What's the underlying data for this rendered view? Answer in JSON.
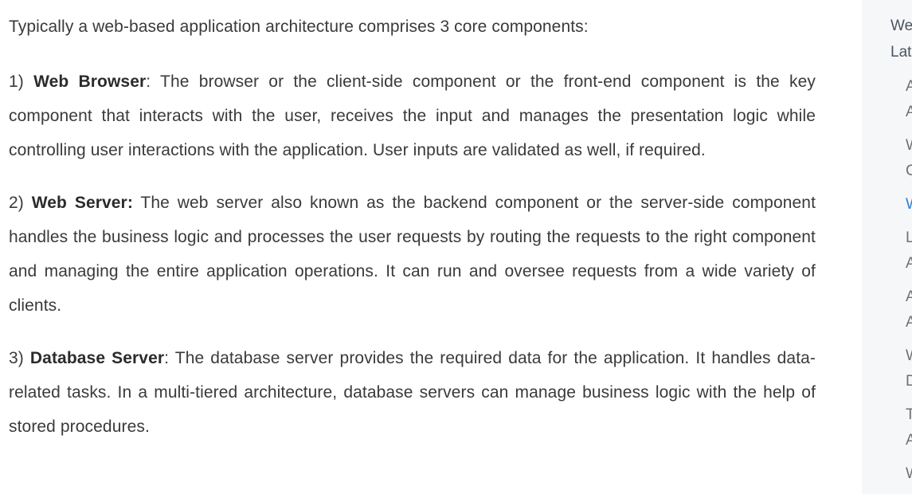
{
  "article": {
    "intro": "Typically a web-based application architecture comprises 3 core components:",
    "items": [
      {
        "num": "1) ",
        "term": "Web Browser",
        "sep": ":",
        "text": " The browser or the client-side component or the front-end component is the key component that interacts with the user, receives the input and manages the presentation logic while controlling user interactions with the application. User inputs are validated as well, if required."
      },
      {
        "num": "2) ",
        "term": "Web Server:",
        "sep": "",
        "text": " The web server also known as the backend component or the server-side component handles the business logic and processes the user requests by routing the requests to the right component and managing the entire application operations. It can run and oversee requests from a wide variety of clients."
      },
      {
        "num": "3) ",
        "term": "Database Server",
        "sep": ":",
        "text": " The database server provides the required data for the application. It handles data-related tasks. In a multi-tiered architecture, database servers can manage business logic with the help of stored procedures."
      }
    ]
  },
  "sidebar": {
    "headings": [
      "We",
      "Lat"
    ],
    "links": [
      "A",
      "A",
      "W",
      "C",
      "W",
      "L",
      "A",
      "A",
      "A",
      "W",
      "D",
      "T",
      "A",
      "W"
    ],
    "active_index": 4,
    "colors": {
      "active_link": "#2d7fd3",
      "link": "#6a7178",
      "background": "#f6f7f8"
    }
  }
}
